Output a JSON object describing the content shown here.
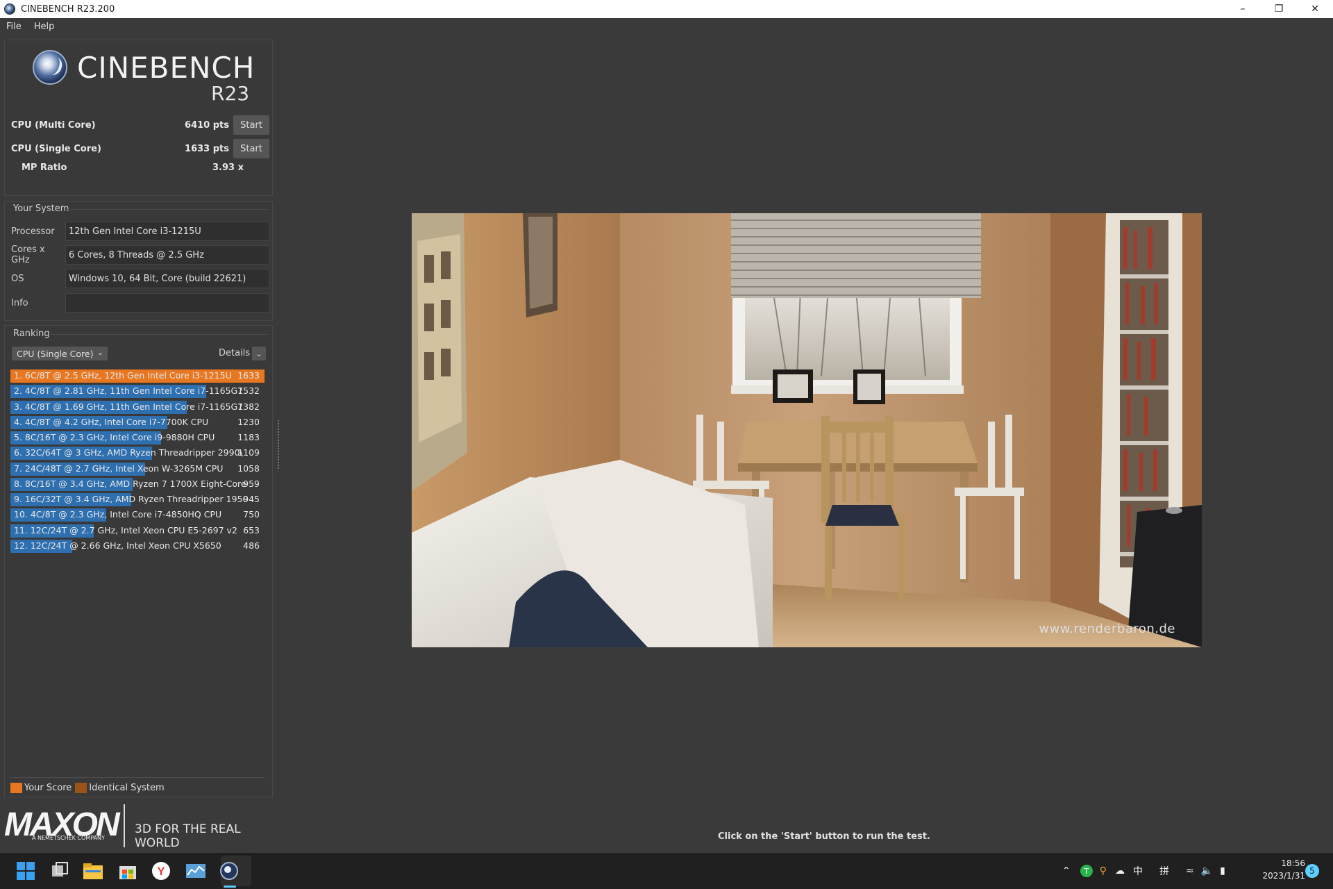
{
  "window": {
    "title": "CINEBENCH R23.200"
  },
  "menu": {
    "file": "File",
    "help": "Help"
  },
  "logo": {
    "name": "CINEBENCH",
    "version": "R23"
  },
  "scores": {
    "multi": {
      "label": "CPU (Multi Core)",
      "value": "6410 pts",
      "button": "Start"
    },
    "single": {
      "label": "CPU (Single Core)",
      "value": "1633 pts",
      "button": "Start"
    },
    "mp": {
      "label": "MP Ratio",
      "value": "3.93 x"
    }
  },
  "system": {
    "title": "Your System",
    "rows": [
      {
        "label": "Processor",
        "value": "12th Gen Intel Core i3-1215U"
      },
      {
        "label": "Cores x GHz",
        "value": "6 Cores, 8 Threads @ 2.5 GHz"
      },
      {
        "label": "OS",
        "value": "Windows 10, 64 Bit, Core (build 22621)"
      },
      {
        "label": "Info",
        "value": ""
      }
    ]
  },
  "ranking": {
    "title": "Ranking",
    "dropdown": "CPU (Single Core)",
    "details": "Details",
    "max_score": 1633,
    "items": [
      {
        "name": "1. 6C/8T @ 2.5 GHz, 12th Gen Intel Core i3-1215U",
        "score": 1633,
        "mine": true
      },
      {
        "name": "2. 4C/8T @ 2.81 GHz, 11th Gen Intel Core i7-1165G7",
        "score": 1532
      },
      {
        "name": "3. 4C/8T @ 1.69 GHz, 11th Gen Intel Core i7-1165G7",
        "score": 1382
      },
      {
        "name": "4. 4C/8T @ 4.2 GHz, Intel Core i7-7700K CPU",
        "score": 1230
      },
      {
        "name": "5. 8C/16T @ 2.3 GHz, Intel Core i9-9880H CPU",
        "score": 1183
      },
      {
        "name": "6. 32C/64T @ 3 GHz, AMD Ryzen Threadripper 2990\\",
        "score": 1109
      },
      {
        "name": "7. 24C/48T @ 2.7 GHz, Intel Xeon W-3265M CPU",
        "score": 1058
      },
      {
        "name": "8. 8C/16T @ 3.4 GHz, AMD Ryzen 7 1700X Eight-Core",
        "score": 959
      },
      {
        "name": "9. 16C/32T @ 3.4 GHz, AMD Ryzen Threadripper 1950",
        "score": 945
      },
      {
        "name": "10. 4C/8T @ 2.3 GHz, Intel Core i7-4850HQ CPU",
        "score": 750
      },
      {
        "name": "11. 12C/24T @ 2.7 GHz, Intel Xeon CPU E5-2697 v2",
        "score": 653
      },
      {
        "name": "12. 12C/24T @ 2.66 GHz, Intel Xeon CPU X5650",
        "score": 486
      }
    ],
    "legend": {
      "your_score": "Your Score",
      "identical": "Identical System"
    }
  },
  "footer": {
    "brand": "MAXON",
    "brand_sub": "A NEMETSCHEK COMPANY",
    "tagline": "3D FOR THE REAL WORLD"
  },
  "render": {
    "watermark": "www.renderbaron.de"
  },
  "status": "Click on the 'Start' button to run the test.",
  "taskbar": {
    "ime": "中",
    "ime2": "拼",
    "time": "18:56",
    "date": "2023/1/31"
  },
  "colors": {
    "your_score": "#e87722",
    "identical": "#9a5418",
    "other": "#2e6fb0",
    "background": "#3a3a3a"
  }
}
